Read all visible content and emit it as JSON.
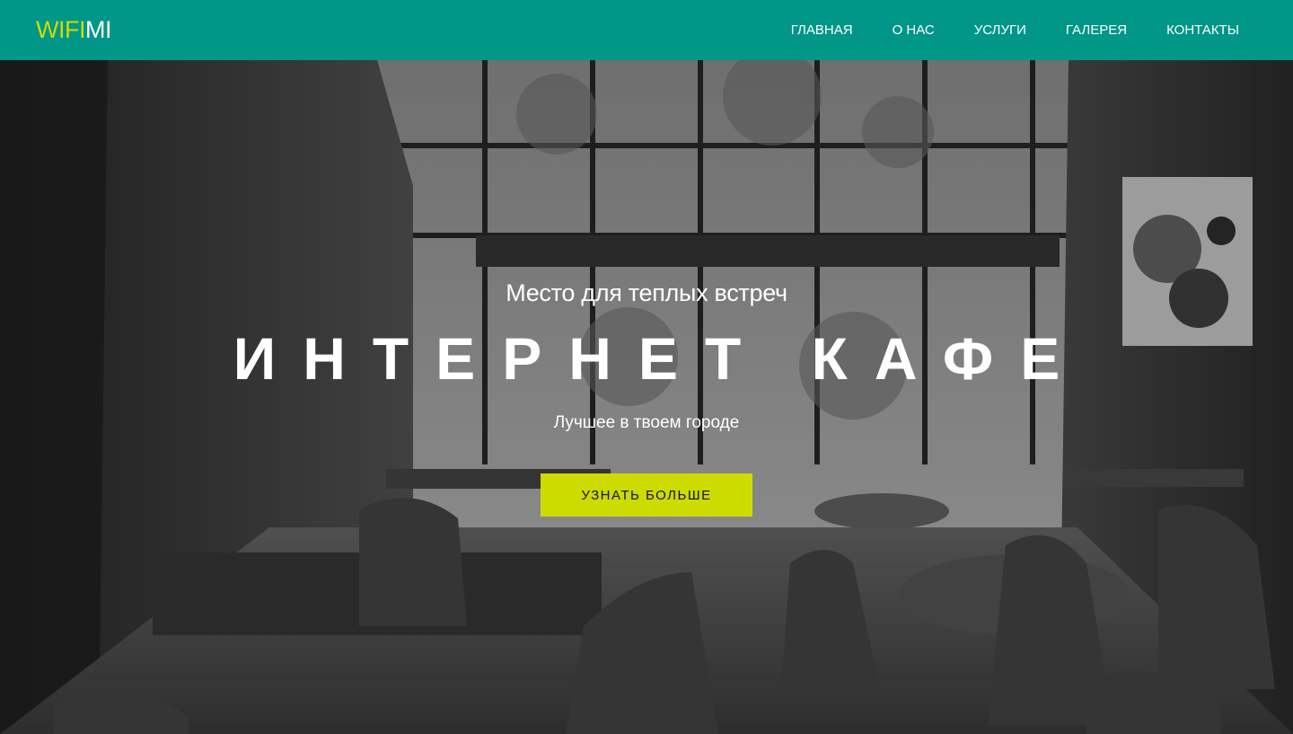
{
  "logo": {
    "part1": "WIFI",
    "part2": "MI"
  },
  "nav": {
    "items": [
      {
        "label": "ГЛАВНАЯ"
      },
      {
        "label": "О НАС"
      },
      {
        "label": "УСЛУГИ"
      },
      {
        "label": "ГАЛЕРЕЯ"
      },
      {
        "label": "КОНТАКТЫ"
      }
    ]
  },
  "hero": {
    "subtitle": "Место для теплых встреч",
    "title": "ИНТЕРНЕТ КАФЕ",
    "tagline": "Лучшее в твоем городе",
    "cta_label": "УЗНАТЬ БОЛЬШЕ",
    "background": "black-and-white cafe interior photo"
  },
  "colors": {
    "header_bg": "#009688",
    "accent": "#cddc00",
    "text": "#ffffff"
  }
}
